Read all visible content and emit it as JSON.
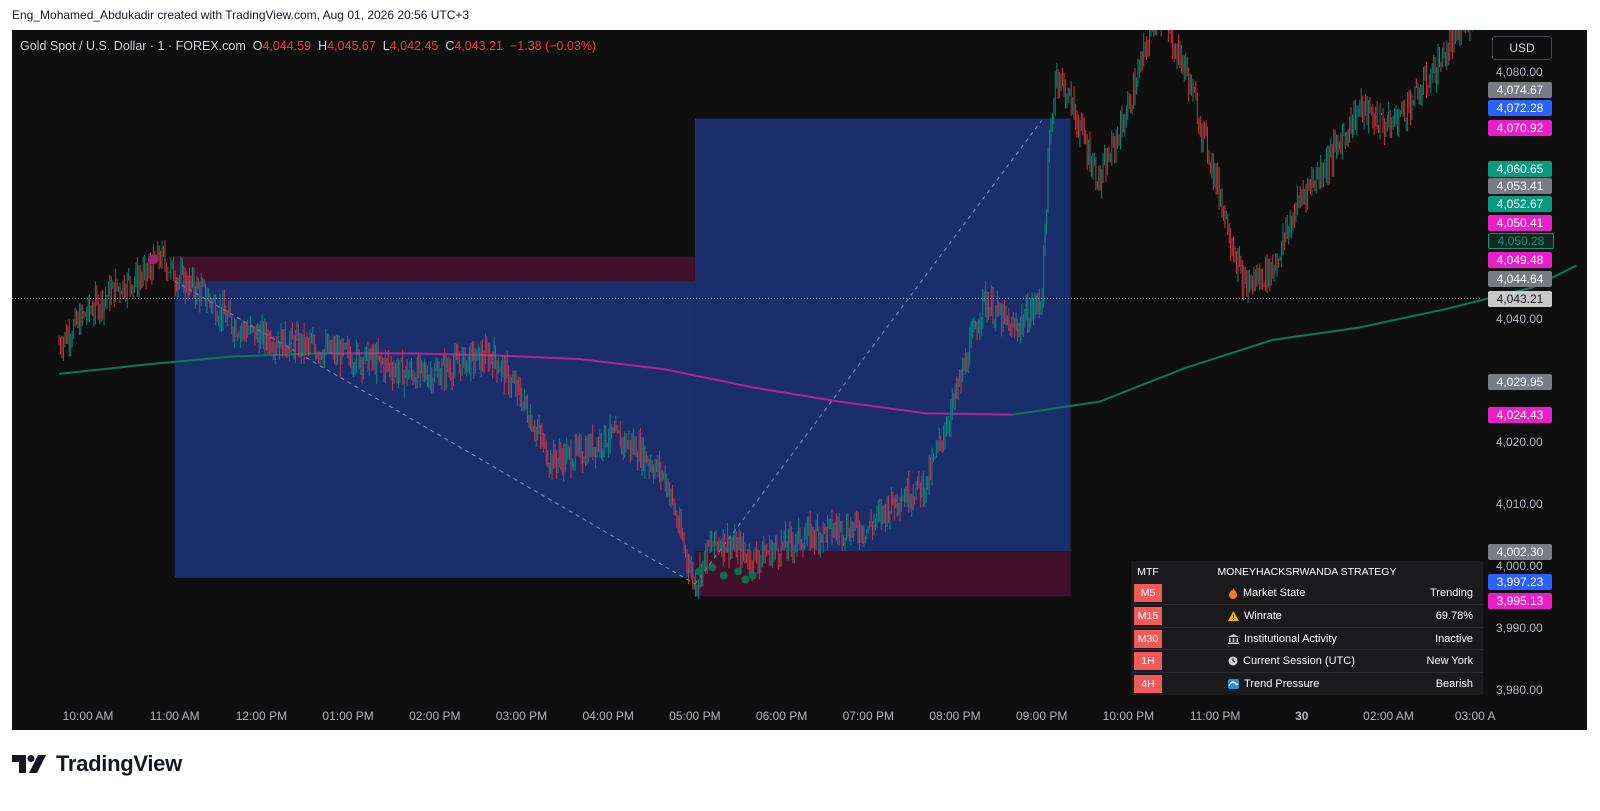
{
  "top_caption": "Eng_Mohamed_Abdukadir created with TradingView.com, Aug 01, 2026 20:56 UTC+3",
  "header": {
    "symbol": "Gold Spot / U.S. Dollar · 1 · FOREX.com",
    "o_label": "O",
    "o_value": "4,044.59",
    "h_label": "H",
    "h_value": "4,045.67",
    "l_label": "L",
    "l_value": "4,042.45",
    "c_label": "C",
    "c_value": "4,043.21",
    "change": "−1.38 (−0.03%)"
  },
  "currency_button": "USD",
  "colors": {
    "background": "#0f0f0f",
    "bull": "#089981",
    "bear": "#f23645",
    "ma_green": "#0b7a52",
    "ma_magenta": "#b0249a",
    "target_zone": "#1e3a8a",
    "stop_zone": "#4a1030"
  },
  "y_axis_ticks": [
    "4,080.00",
    "4,040.00",
    "4,020.00",
    "4,010.00",
    "4,000.00",
    "3,990.00",
    "3,980.00"
  ],
  "price_tags": [
    {
      "text": "4,074.67",
      "bg": "#787b86"
    },
    {
      "text": "4,072.28",
      "bg": "#2962ff"
    },
    {
      "text": "4,070.92",
      "bg": "#e91ec9"
    },
    {
      "text": "4,060.65",
      "bg": "#089981"
    },
    {
      "text": "4,053.41",
      "bg": "#787b86"
    },
    {
      "text": "4,052.67",
      "bg": "#089981"
    },
    {
      "text": "4,050.41",
      "bg": "#e91ec9"
    },
    {
      "text": "4,050.28",
      "bg": "#0f2a1c"
    },
    {
      "text": "4,049.48",
      "bg": "#e91ec9"
    },
    {
      "text": "4,044.64",
      "bg": "#787b86"
    },
    {
      "text": "4,043.21",
      "bg": "#c8c8c8"
    },
    {
      "text": "4,029.95",
      "bg": "#787b86"
    },
    {
      "text": "4,024.43",
      "bg": "#e91ec9"
    },
    {
      "text": "4,002.30",
      "bg": "#787b86"
    },
    {
      "text": "3,997.23",
      "bg": "#2962ff"
    },
    {
      "text": "3,995.13",
      "bg": "#e91ec9"
    }
  ],
  "x_axis_ticks": [
    "10:00 AM",
    "11:00 AM",
    "12:00 PM",
    "01:00 PM",
    "02:00 PM",
    "03:00 PM",
    "04:00 PM",
    "05:00 PM",
    "06:00 PM",
    "07:00 PM",
    "08:00 PM",
    "09:00 PM",
    "10:00 PM",
    "11:00 PM",
    "30",
    "02:00 AM",
    "03:00 A"
  ],
  "mtf_table": {
    "header_left": "MTF",
    "header_title": "MONEYHACKSRWANDA STRATEGY",
    "rows": [
      {
        "tf": "M5",
        "icon": "fire-icon",
        "label": "Market State",
        "value": "Trending"
      },
      {
        "tf": "M15",
        "icon": "warning-icon",
        "label": "Winrate",
        "value": "69.78%"
      },
      {
        "tf": "M30",
        "icon": "bank-icon",
        "label": "Institutional Activity",
        "value": "Inactive"
      },
      {
        "tf": "1H",
        "icon": "clock-icon",
        "label": "Current Session (UTC)",
        "value": "New York"
      },
      {
        "tf": "4H",
        "icon": "wave-icon",
        "label": "Trend Pressure",
        "value": "Bearish"
      }
    ]
  },
  "brand": {
    "text": "TradingView"
  },
  "chart_data": {
    "type": "line",
    "title": "Gold Spot / U.S. Dollar · 1 · FOREX.com",
    "ylim": [
      3975,
      4090
    ],
    "x": [
      "09:40",
      "10:00",
      "10:20",
      "10:40",
      "10:50",
      "11:00",
      "11:20",
      "11:40",
      "12:00",
      "12:20",
      "12:40",
      "13:00",
      "13:20",
      "13:40",
      "14:00",
      "14:20",
      "14:40",
      "15:00",
      "15:20",
      "15:40",
      "16:00",
      "16:20",
      "16:40",
      "16:50",
      "17:00",
      "17:10",
      "17:20",
      "17:40",
      "18:00",
      "18:20",
      "18:40",
      "19:00",
      "19:20",
      "19:40",
      "20:00",
      "20:20",
      "20:40",
      "21:00",
      "21:05",
      "21:10",
      "21:20",
      "21:40",
      "22:00",
      "22:20",
      "22:40",
      "23:00",
      "23:20",
      "23:40",
      "00:00",
      "00:20",
      "00:40",
      "01:00",
      "01:20",
      "01:40",
      "02:00",
      "02:20",
      "02:40",
      "03:00",
      "03:10"
    ],
    "series": [
      {
        "name": "",
        "values": [
          4036,
          4041,
          4045,
          4047,
          4050,
          4047,
          4044,
          4039,
          4037,
          4036,
          4035,
          4034,
          4033,
          4031,
          4031,
          4033,
          4034,
          4027,
          4017,
          4018,
          4021,
          4019,
          4014,
          4005,
          3997,
          4003,
          4004,
          4001,
          4003,
          4005,
          4006,
          4006,
          4011,
          4013,
          4027,
          4043,
          4038,
          4043,
          4067,
          4080,
          4075,
          4062,
          4074,
          4090,
          4080,
          4063,
          4045,
          4048,
          4060,
          4066,
          4074,
          4071,
          4076,
          4083,
          4090,
          4092,
          4088,
          4080,
          4082
        ]
      }
    ],
    "moving_averages": [
      {
        "name": "",
        "x": [
          "09:40",
          "10:40",
          "11:40",
          "12:40",
          "13:40",
          "14:40",
          "15:40",
          "16:40",
          "17:40",
          "18:40",
          "19:40",
          "20:40",
          "21:40",
          "22:40",
          "23:40",
          "00:40",
          "01:40",
          "02:40",
          "03:10"
        ],
        "values": [
          4031,
          4032.5,
          4033.8,
          4034.3,
          4034.3,
          4034,
          4033.4,
          4031.7,
          4028.8,
          4026.5,
          4024.6,
          4024.4,
          4026.5,
          4032,
          4036.5,
          4038.5,
          4041.5,
          4045,
          4048.5
        ]
      }
    ],
    "zones": [
      {
        "kind": "target",
        "x_start": "11:00",
        "x_end": "17:00",
        "y_top": 4046,
        "y_bottom": 3998
      },
      {
        "kind": "stop",
        "x_start": "11:00",
        "x_end": "17:00",
        "y_top": 4050,
        "y_bottom": 4046
      },
      {
        "kind": "stop",
        "x_start": "17:00",
        "x_end": "21:20",
        "y_top": 4002.3,
        "y_bottom": 3995
      },
      {
        "kind": "target",
        "x_start": "17:00",
        "x_end": "21:20",
        "y_top": 4072.3,
        "y_bottom": 4002.3
      }
    ],
    "current_price": 4043.21,
    "grid": false,
    "legend": "none"
  }
}
